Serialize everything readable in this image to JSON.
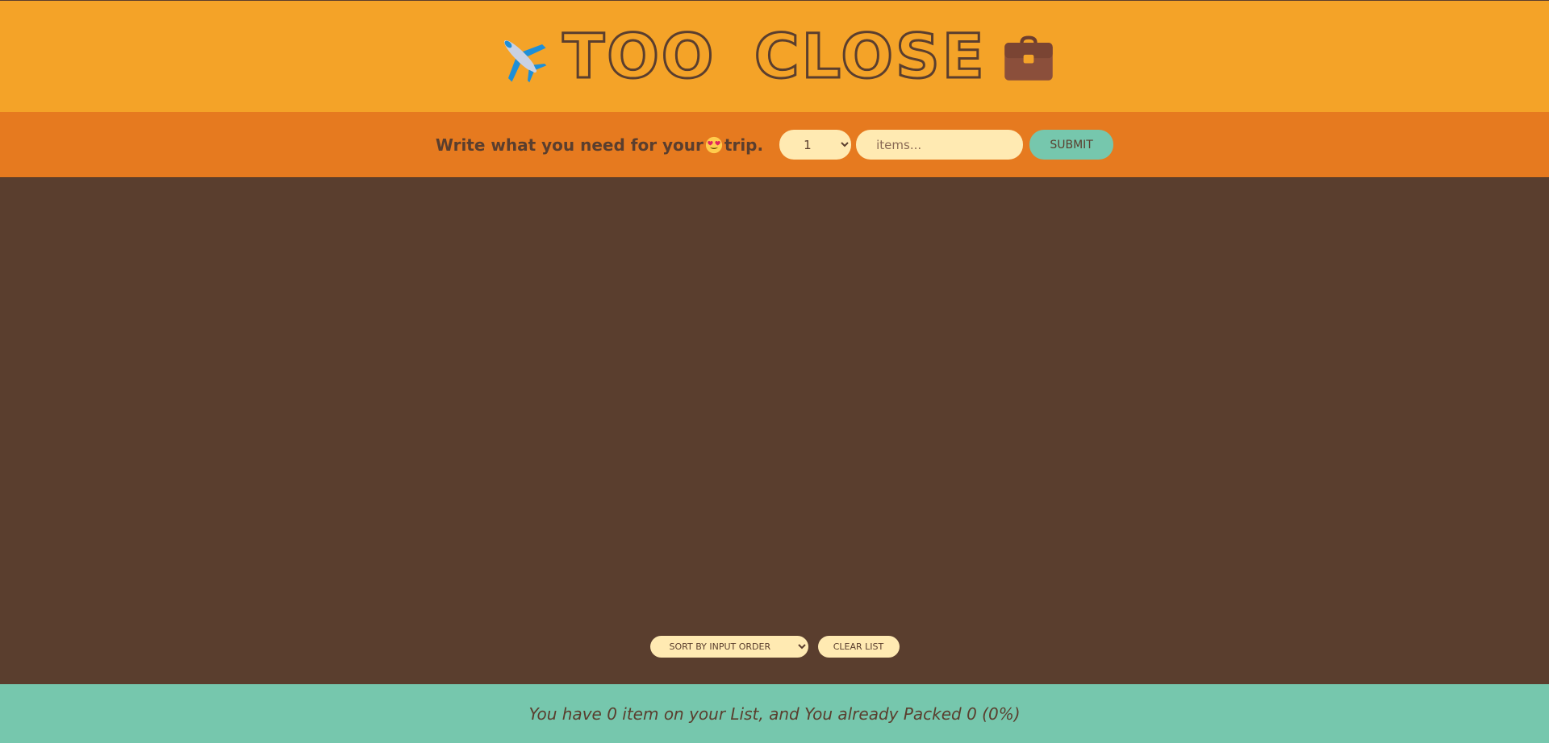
{
  "app": {
    "title": "TOO CLOSE",
    "left_icon": "airplane-icon",
    "right_icon": "briefcase-icon"
  },
  "form": {
    "prompt_before": "Write what you need for your",
    "prompt_emoji": "smiling-face-with-heart-eyes-icon",
    "prompt_after": "trip.",
    "quantity_selected": "1",
    "items_placeholder": "items...",
    "items_value": "",
    "submit_label": "SUBMIT"
  },
  "list": {
    "items": []
  },
  "actions": {
    "sort_selected": "SORT BY INPUT ORDER",
    "clear_label": "CLEAR LIST"
  },
  "stats": {
    "text": "You have 0 item on your List, and You already Packed 0 (0%)"
  },
  "colors": {
    "header_bg": "#f4a328",
    "form_bg": "#e67a1f",
    "list_bg": "#5a3e2e",
    "footer_bg": "#76c7ad",
    "input_bg": "#ffeab2",
    "text": "#5a3e2e"
  }
}
